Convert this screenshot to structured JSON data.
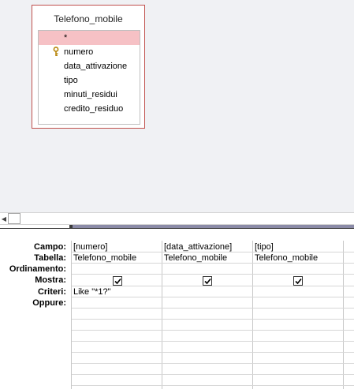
{
  "table": {
    "name": "Telefono_mobile",
    "fields": [
      {
        "label": "*",
        "key": false,
        "selected": true
      },
      {
        "label": "numero",
        "key": true,
        "selected": false
      },
      {
        "label": "data_attivazione",
        "key": false,
        "selected": false
      },
      {
        "label": "tipo",
        "key": false,
        "selected": false
      },
      {
        "label": "minuti_residui",
        "key": false,
        "selected": false
      },
      {
        "label": "credito_residuo",
        "key": false,
        "selected": false
      }
    ]
  },
  "grid": {
    "row_labels": [
      "Campo:",
      "Tabella:",
      "Ordinamento:",
      "Mostra:",
      "Criteri:",
      "Oppure:"
    ],
    "columns": [
      {
        "campo": "[numero]",
        "tabella": "Telefono_mobile",
        "ordinamento": "",
        "mostra": true,
        "criteri": "Like \"*1?\"",
        "oppure": ""
      },
      {
        "campo": "[data_attivazione]",
        "tabella": "Telefono_mobile",
        "ordinamento": "",
        "mostra": true,
        "criteri": "",
        "oppure": ""
      },
      {
        "campo": "[tipo]",
        "tabella": "Telefono_mobile",
        "ordinamento": "",
        "mostra": true,
        "criteri": "",
        "oppure": ""
      }
    ]
  },
  "colors": {
    "accent_border": "#c0504d",
    "selected_field": "#f6c1c5"
  },
  "icons": {
    "key": "key-icon",
    "scroll_left": "scroll-left-arrow-icon",
    "check": "checkmark-icon"
  }
}
